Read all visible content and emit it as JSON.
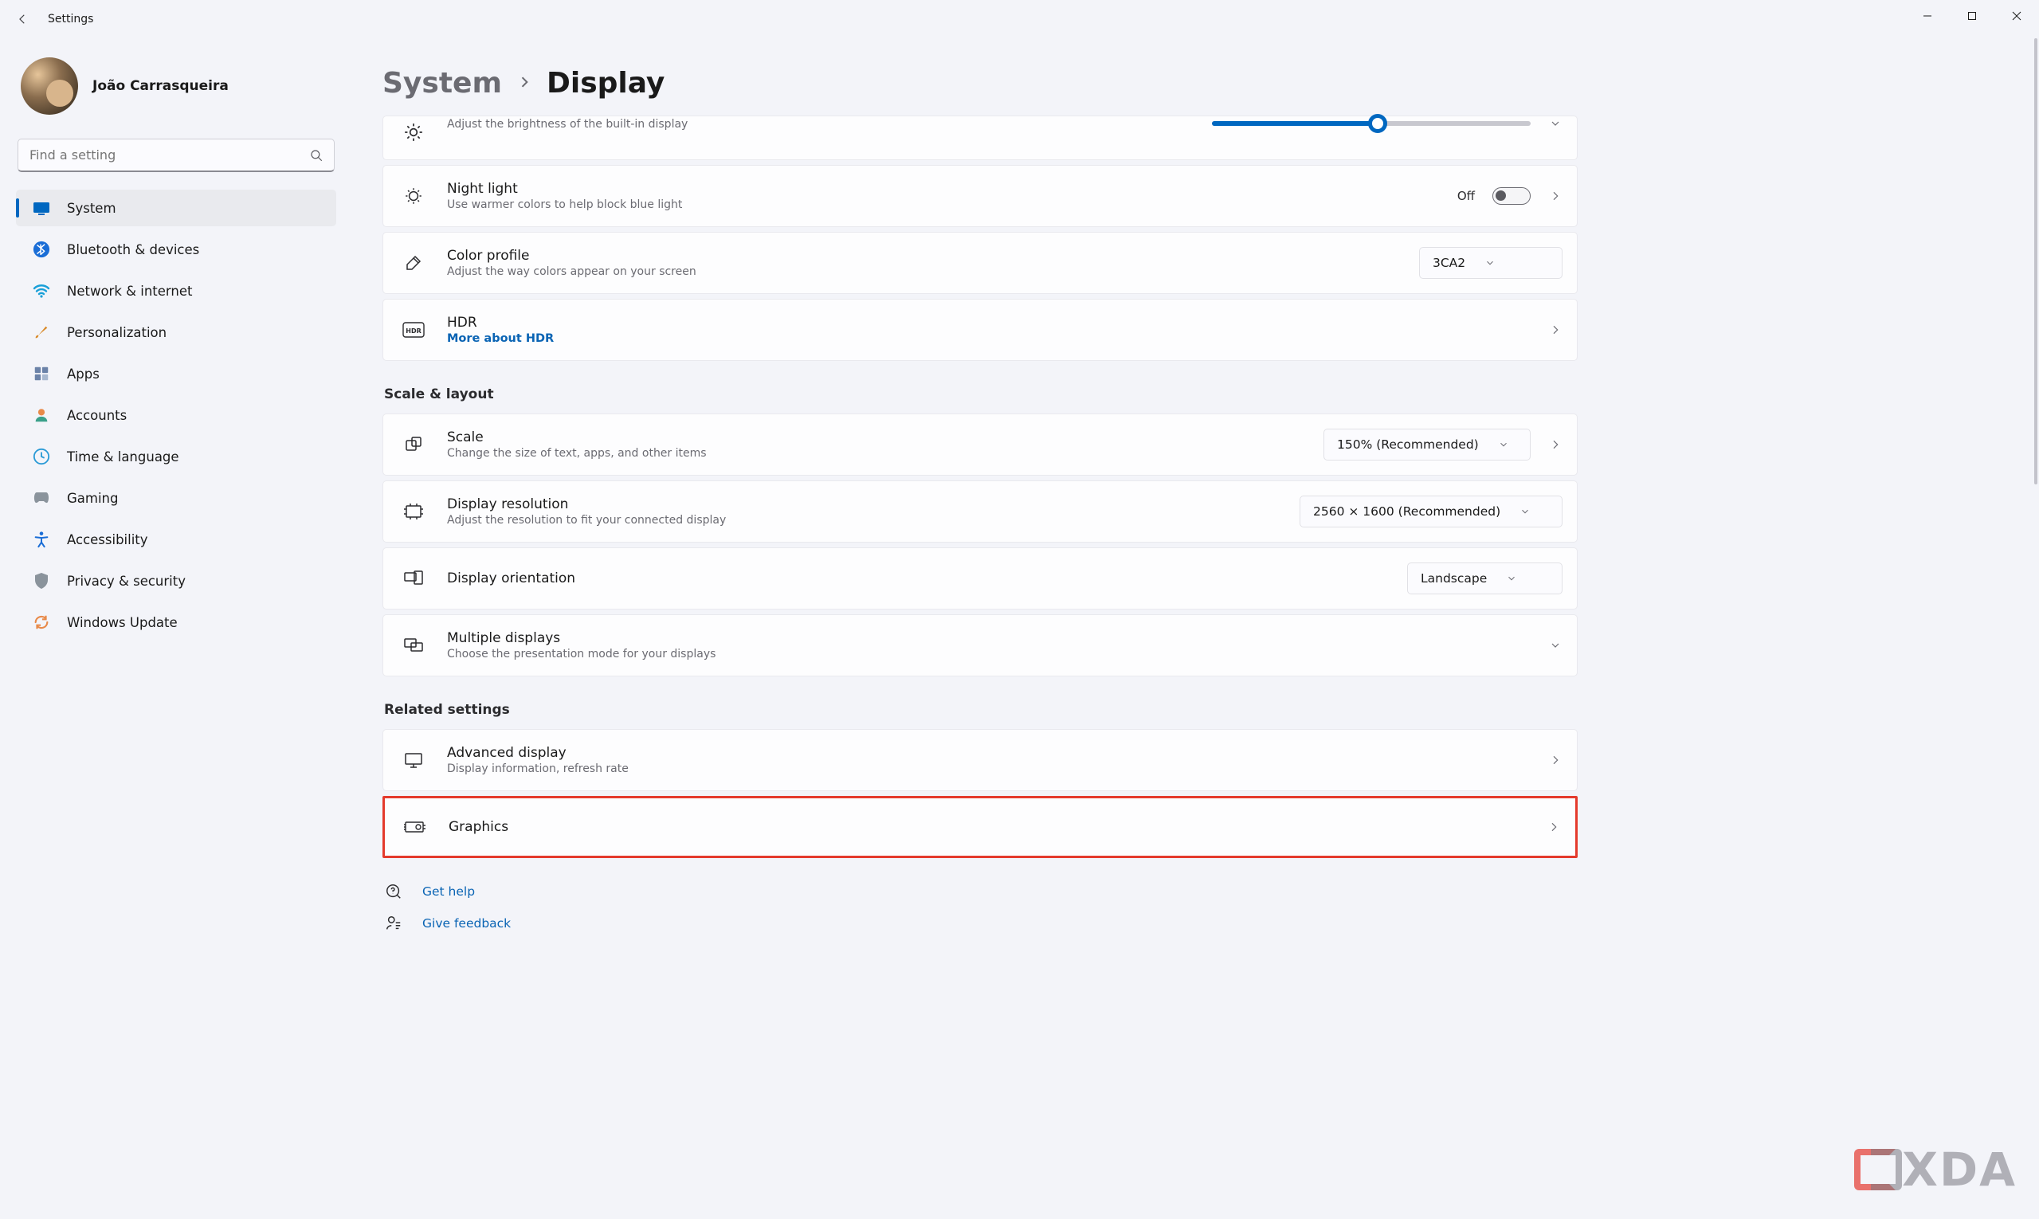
{
  "window": {
    "title": "Settings",
    "user_name": "João Carrasqueira"
  },
  "search": {
    "placeholder": "Find a setting"
  },
  "sidebar": {
    "items": [
      {
        "label": "System"
      },
      {
        "label": "Bluetooth & devices"
      },
      {
        "label": "Network & internet"
      },
      {
        "label": "Personalization"
      },
      {
        "label": "Apps"
      },
      {
        "label": "Accounts"
      },
      {
        "label": "Time & language"
      },
      {
        "label": "Gaming"
      },
      {
        "label": "Accessibility"
      },
      {
        "label": "Privacy & security"
      },
      {
        "label": "Windows Update"
      }
    ]
  },
  "breadcrumb": {
    "parent": "System",
    "current": "Display"
  },
  "brightness": {
    "subtitle": "Adjust the brightness of the built-in display",
    "value_pct": 52
  },
  "night_light": {
    "title": "Night light",
    "subtitle": "Use warmer colors to help block blue light",
    "state_label": "Off"
  },
  "color_profile": {
    "title": "Color profile",
    "subtitle": "Adjust the way colors appear on your screen",
    "selected": "3CA2"
  },
  "hdr": {
    "title": "HDR",
    "link": "More about HDR"
  },
  "sections": {
    "scale_layout": "Scale & layout",
    "related": "Related settings"
  },
  "scale": {
    "title": "Scale",
    "subtitle": "Change the size of text, apps, and other items",
    "selected": "150% (Recommended)"
  },
  "resolution": {
    "title": "Display resolution",
    "subtitle": "Adjust the resolution to fit your connected display",
    "selected": "2560 × 1600 (Recommended)"
  },
  "orientation": {
    "title": "Display orientation",
    "selected": "Landscape"
  },
  "multiple_displays": {
    "title": "Multiple displays",
    "subtitle": "Choose the presentation mode for your displays"
  },
  "advanced_display": {
    "title": "Advanced display",
    "subtitle": "Display information, refresh rate"
  },
  "graphics": {
    "title": "Graphics"
  },
  "help": {
    "get_help": "Get help",
    "give_feedback": "Give feedback"
  },
  "watermark": "XDA"
}
